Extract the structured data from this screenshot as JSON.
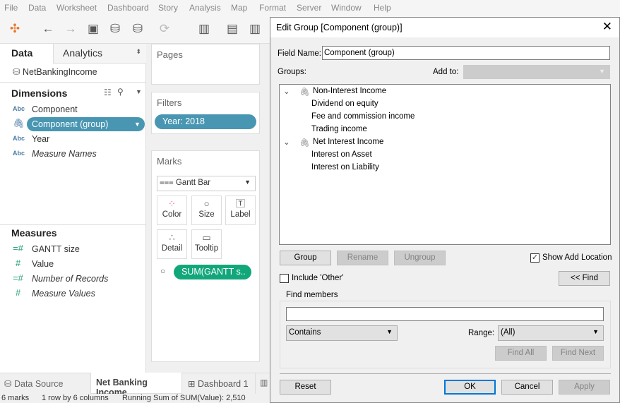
{
  "menu": [
    "File",
    "Data",
    "Worksheet",
    "Dashboard",
    "Story",
    "Analysis",
    "Map",
    "Format",
    "Server",
    "Window",
    "Help"
  ],
  "left": {
    "tabs": {
      "data": "Data",
      "analytics": "Analytics"
    },
    "datasource": "NetBankingIncome",
    "dimensions_title": "Dimensions",
    "dimensions": [
      {
        "type": "Abc",
        "label": "Component"
      },
      {
        "type": "group",
        "label": "Component (group)"
      },
      {
        "type": "Abc",
        "label": "Year"
      },
      {
        "type": "Abc",
        "label": "Measure Names"
      }
    ],
    "measures_title": "Measures",
    "measures": [
      {
        "type": "=#",
        "label": "GANTT size"
      },
      {
        "type": "#",
        "label": "Value"
      },
      {
        "type": "=#",
        "label": "Number of Records"
      },
      {
        "type": "#",
        "label": "Measure Values"
      }
    ]
  },
  "shelves": {
    "pages": "Pages",
    "filters": "Filters",
    "filter_pill": "Year: 2018",
    "marks": "Marks",
    "mark_type": "Gantt Bar",
    "buttons": [
      "Color",
      "Size",
      "Label",
      "Detail",
      "Tooltip"
    ],
    "size_pill": "SUM(GANTT s.."
  },
  "tabs": {
    "datasource": "Data Source",
    "sheet": "Net Banking Income",
    "dashboard": "Dashboard 1"
  },
  "status": {
    "marks": "6 marks",
    "rows": "1 row by 6 columns",
    "sum": "Running Sum of SUM(Value): 2,510"
  },
  "dialog": {
    "title": "Edit Group [Component (group)]",
    "field_name_label": "Field Name:",
    "field_name": "Component (group)",
    "groups_label": "Groups:",
    "add_to_label": "Add to:",
    "groups": [
      {
        "name": "Non-Interest Income",
        "members": [
          "Dividend on equity",
          "Fee and commission income",
          "Trading income"
        ]
      },
      {
        "name": "Net Interest Income",
        "members": [
          "Interest on Asset",
          "Interest on Liability"
        ]
      }
    ],
    "group_btn": "Group",
    "rename_btn": "Rename",
    "ungroup_btn": "Ungroup",
    "show_add_location": "Show Add Location",
    "include_other": "Include 'Other'",
    "find_btn": "<< Find",
    "find_members": "Find members",
    "find_value": "",
    "match": "Contains",
    "range_label": "Range:",
    "range": "(All)",
    "find_all": "Find All",
    "find_next": "Find Next",
    "reset": "Reset",
    "ok": "OK",
    "cancel": "Cancel",
    "apply": "Apply"
  }
}
